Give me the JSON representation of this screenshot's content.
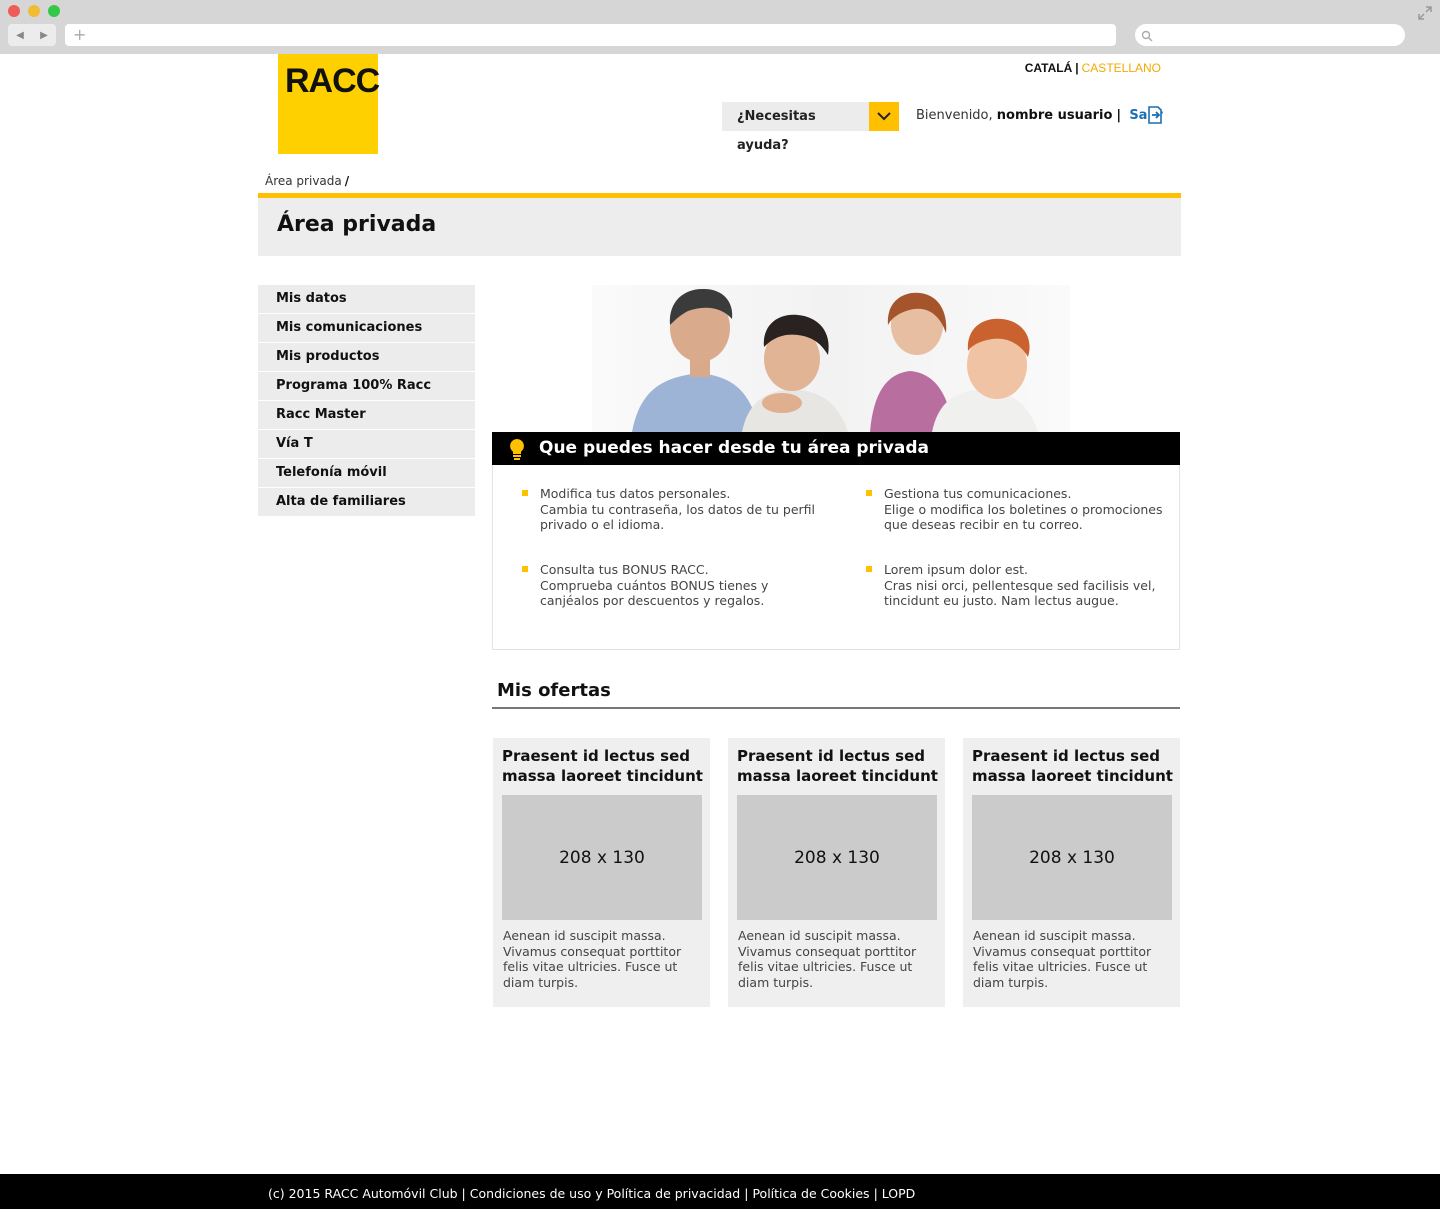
{
  "browser": {
    "nav_back": "◀",
    "nav_forward": "▶",
    "new_tab": "+",
    "search_icon": "search-icon",
    "expand_icon": "expand-icon"
  },
  "brand": {
    "logo_text": "RACC",
    "accent": "#ffc000",
    "logo_color": "#ffd000"
  },
  "header": {
    "lang_active": "CATALÁ",
    "lang_sep": "|",
    "lang_other": "CASTELLANO",
    "help_label": "¿Necesitas ayuda?",
    "welcome": "Bienvenido,",
    "username": "nombre usuario",
    "user_sep": "|",
    "logout": "Salir"
  },
  "breadcrumb": {
    "item": "Área privada",
    "sep": "/"
  },
  "page": {
    "title": "Área privada"
  },
  "sidebar": {
    "items": [
      {
        "label": "Mis datos"
      },
      {
        "label": "Mis comunicaciones"
      },
      {
        "label": "Mis productos"
      },
      {
        "label": "Programa 100% Racc"
      },
      {
        "label": "Racc Master"
      },
      {
        "label": "Vía T"
      },
      {
        "label": "Telefonía móvil"
      },
      {
        "label": "Alta de familiares"
      }
    ]
  },
  "info": {
    "title": "Que puedes hacer desde tu área privada",
    "items": [
      {
        "title": "Modifica tus datos personales.",
        "desc": "Cambia tu contraseña, los datos de tu perfil privado o el idioma."
      },
      {
        "title": "Gestiona tus comunicaciones.",
        "desc": "Elige o modifica los boletines o promociones que deseas recibir en tu correo."
      },
      {
        "title": "Consulta tus BONUS RACC.",
        "desc": "Comprueba cuántos BONUS tienes y canjéalos por descuentos y regalos."
      },
      {
        "title": "Lorem ipsum dolor est.",
        "desc": "Cras nisi orci, pellentesque sed facilisis vel, tincidunt eu justo. Nam lectus augue."
      }
    ]
  },
  "offers": {
    "title": "Mis ofertas",
    "cards": [
      {
        "title": "Praesent id lectus sed massa laoreet tincidunt",
        "image_label": "208 x 130",
        "text": "Aenean id suscipit massa. Vivamus consequat porttitor felis vitae ultricies. Fusce ut diam turpis."
      },
      {
        "title": "Praesent id lectus sed massa laoreet tincidunt",
        "image_label": "208 x 130",
        "text": "Aenean id suscipit massa. Vivamus consequat porttitor felis vitae ultricies. Fusce ut diam turpis."
      },
      {
        "title": "Praesent id lectus sed massa laoreet tincidunt",
        "image_label": "208 x 130",
        "text": "Aenean id suscipit massa. Vivamus consequat porttitor felis vitae ultricies. Fusce ut diam turpis."
      }
    ]
  },
  "footer": {
    "copyright": "(c) 2015 RACC Automóvil Club",
    "sep": "|",
    "terms": "Condiciones de uso y Política de privacidad",
    "cookies": "Política de Cookies",
    "lopd": "LOPD"
  }
}
